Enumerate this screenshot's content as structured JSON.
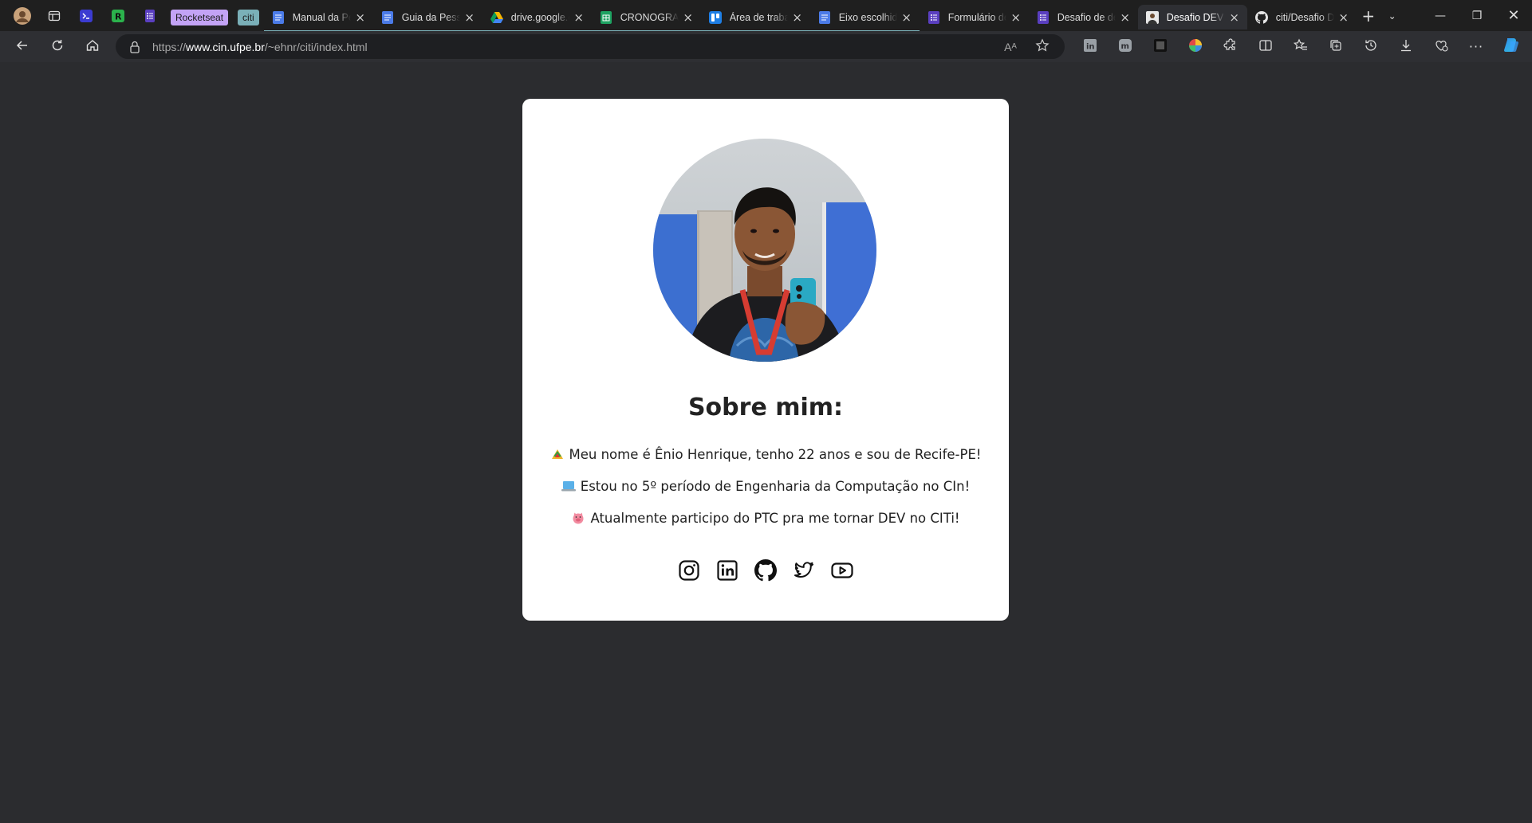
{
  "browser": {
    "tabs": [
      {
        "kind": "pinned",
        "icon": "profile-avatar-icon"
      },
      {
        "kind": "pinned",
        "icon": "tab-actions-icon"
      },
      {
        "kind": "pinned",
        "icon": "terminal-icon",
        "color": "#3b3bd1"
      },
      {
        "kind": "pinned",
        "icon": "rocket-r-icon",
        "color": "#2bb24c"
      },
      {
        "kind": "pinned",
        "icon": "forms-icon",
        "color": "#5a3fc0"
      },
      {
        "kind": "group",
        "label": "Rocketseat",
        "color": "#c3a3f5"
      },
      {
        "kind": "group",
        "label": "citi",
        "color": "#7ab0b8"
      },
      {
        "kind": "tab",
        "title": "Manual da Pessoa",
        "icon": "docs-icon"
      },
      {
        "kind": "tab",
        "title": "Guia da Pessoa",
        "icon": "docs-icon"
      },
      {
        "kind": "tab",
        "title": "drive.google.com",
        "icon": "drive-icon"
      },
      {
        "kind": "tab",
        "title": "CRONOGRAMA",
        "icon": "sheets-icon"
      },
      {
        "kind": "tab",
        "title": "Área de trabalho",
        "icon": "trello-icon"
      },
      {
        "kind": "tab",
        "title": "Eixo escolhido",
        "icon": "docs-icon"
      },
      {
        "kind": "tab",
        "title": "Formulário de",
        "icon": "forms-icon"
      },
      {
        "kind": "tab",
        "title": "Desafio de dev",
        "icon": "forms-icon"
      },
      {
        "kind": "tab",
        "title": "Desafio DEV | CITi",
        "icon": "page-icon",
        "active": true
      },
      {
        "kind": "tab",
        "title": "citi/Desafio DEV",
        "icon": "github-icon"
      }
    ],
    "address": {
      "url_prefix": "https://",
      "url_host": "www.cin.ufpe.br",
      "url_path": "/~ehnr/citi/index.html"
    }
  },
  "profile": {
    "heading": "Sobre mim:",
    "lines": [
      {
        "emoji": "flag-icon",
        "text": "Meu nome é Ênio Henrique, tenho 22 anos e sou de Recife-PE!"
      },
      {
        "emoji": "laptop-icon",
        "text": "Estou no 5º período de Engenharia da Computação no CIn!"
      },
      {
        "emoji": "pig-icon",
        "text": "Atualmente participo do PTC pra me tornar DEV no CITi!"
      }
    ],
    "socials": [
      "instagram-icon",
      "linkedin-icon",
      "github-icon",
      "twitter-icon",
      "youtube-icon"
    ]
  },
  "colors": {
    "page_bg": "#2b2c2f",
    "card_bg": "#ffffff",
    "text": "#1f1f1f",
    "chrome_bg": "#1f1f1f",
    "toolbar_bg": "#2e2f33"
  }
}
